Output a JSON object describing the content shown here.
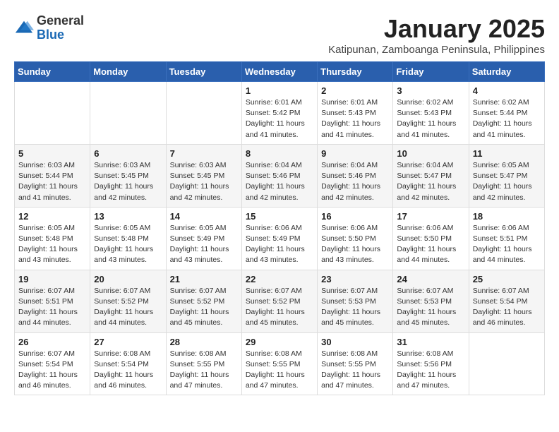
{
  "logo": {
    "general": "General",
    "blue": "Blue"
  },
  "title": {
    "month": "January 2025",
    "location": "Katipunan, Zamboanga Peninsula, Philippines"
  },
  "weekdays": [
    "Sunday",
    "Monday",
    "Tuesday",
    "Wednesday",
    "Thursday",
    "Friday",
    "Saturday"
  ],
  "weeks": [
    [
      {
        "day": "",
        "info": ""
      },
      {
        "day": "",
        "info": ""
      },
      {
        "day": "",
        "info": ""
      },
      {
        "day": "1",
        "info": "Sunrise: 6:01 AM\nSunset: 5:42 PM\nDaylight: 11 hours\nand 41 minutes."
      },
      {
        "day": "2",
        "info": "Sunrise: 6:01 AM\nSunset: 5:43 PM\nDaylight: 11 hours\nand 41 minutes."
      },
      {
        "day": "3",
        "info": "Sunrise: 6:02 AM\nSunset: 5:43 PM\nDaylight: 11 hours\nand 41 minutes."
      },
      {
        "day": "4",
        "info": "Sunrise: 6:02 AM\nSunset: 5:44 PM\nDaylight: 11 hours\nand 41 minutes."
      }
    ],
    [
      {
        "day": "5",
        "info": "Sunrise: 6:03 AM\nSunset: 5:44 PM\nDaylight: 11 hours\nand 41 minutes."
      },
      {
        "day": "6",
        "info": "Sunrise: 6:03 AM\nSunset: 5:45 PM\nDaylight: 11 hours\nand 42 minutes."
      },
      {
        "day": "7",
        "info": "Sunrise: 6:03 AM\nSunset: 5:45 PM\nDaylight: 11 hours\nand 42 minutes."
      },
      {
        "day": "8",
        "info": "Sunrise: 6:04 AM\nSunset: 5:46 PM\nDaylight: 11 hours\nand 42 minutes."
      },
      {
        "day": "9",
        "info": "Sunrise: 6:04 AM\nSunset: 5:46 PM\nDaylight: 11 hours\nand 42 minutes."
      },
      {
        "day": "10",
        "info": "Sunrise: 6:04 AM\nSunset: 5:47 PM\nDaylight: 11 hours\nand 42 minutes."
      },
      {
        "day": "11",
        "info": "Sunrise: 6:05 AM\nSunset: 5:47 PM\nDaylight: 11 hours\nand 42 minutes."
      }
    ],
    [
      {
        "day": "12",
        "info": "Sunrise: 6:05 AM\nSunset: 5:48 PM\nDaylight: 11 hours\nand 43 minutes."
      },
      {
        "day": "13",
        "info": "Sunrise: 6:05 AM\nSunset: 5:48 PM\nDaylight: 11 hours\nand 43 minutes."
      },
      {
        "day": "14",
        "info": "Sunrise: 6:05 AM\nSunset: 5:49 PM\nDaylight: 11 hours\nand 43 minutes."
      },
      {
        "day": "15",
        "info": "Sunrise: 6:06 AM\nSunset: 5:49 PM\nDaylight: 11 hours\nand 43 minutes."
      },
      {
        "day": "16",
        "info": "Sunrise: 6:06 AM\nSunset: 5:50 PM\nDaylight: 11 hours\nand 43 minutes."
      },
      {
        "day": "17",
        "info": "Sunrise: 6:06 AM\nSunset: 5:50 PM\nDaylight: 11 hours\nand 44 minutes."
      },
      {
        "day": "18",
        "info": "Sunrise: 6:06 AM\nSunset: 5:51 PM\nDaylight: 11 hours\nand 44 minutes."
      }
    ],
    [
      {
        "day": "19",
        "info": "Sunrise: 6:07 AM\nSunset: 5:51 PM\nDaylight: 11 hours\nand 44 minutes."
      },
      {
        "day": "20",
        "info": "Sunrise: 6:07 AM\nSunset: 5:52 PM\nDaylight: 11 hours\nand 44 minutes."
      },
      {
        "day": "21",
        "info": "Sunrise: 6:07 AM\nSunset: 5:52 PM\nDaylight: 11 hours\nand 45 minutes."
      },
      {
        "day": "22",
        "info": "Sunrise: 6:07 AM\nSunset: 5:52 PM\nDaylight: 11 hours\nand 45 minutes."
      },
      {
        "day": "23",
        "info": "Sunrise: 6:07 AM\nSunset: 5:53 PM\nDaylight: 11 hours\nand 45 minutes."
      },
      {
        "day": "24",
        "info": "Sunrise: 6:07 AM\nSunset: 5:53 PM\nDaylight: 11 hours\nand 45 minutes."
      },
      {
        "day": "25",
        "info": "Sunrise: 6:07 AM\nSunset: 5:54 PM\nDaylight: 11 hours\nand 46 minutes."
      }
    ],
    [
      {
        "day": "26",
        "info": "Sunrise: 6:07 AM\nSunset: 5:54 PM\nDaylight: 11 hours\nand 46 minutes."
      },
      {
        "day": "27",
        "info": "Sunrise: 6:08 AM\nSunset: 5:54 PM\nDaylight: 11 hours\nand 46 minutes."
      },
      {
        "day": "28",
        "info": "Sunrise: 6:08 AM\nSunset: 5:55 PM\nDaylight: 11 hours\nand 47 minutes."
      },
      {
        "day": "29",
        "info": "Sunrise: 6:08 AM\nSunset: 5:55 PM\nDaylight: 11 hours\nand 47 minutes."
      },
      {
        "day": "30",
        "info": "Sunrise: 6:08 AM\nSunset: 5:55 PM\nDaylight: 11 hours\nand 47 minutes."
      },
      {
        "day": "31",
        "info": "Sunrise: 6:08 AM\nSunset: 5:56 PM\nDaylight: 11 hours\nand 47 minutes."
      },
      {
        "day": "",
        "info": ""
      }
    ]
  ]
}
